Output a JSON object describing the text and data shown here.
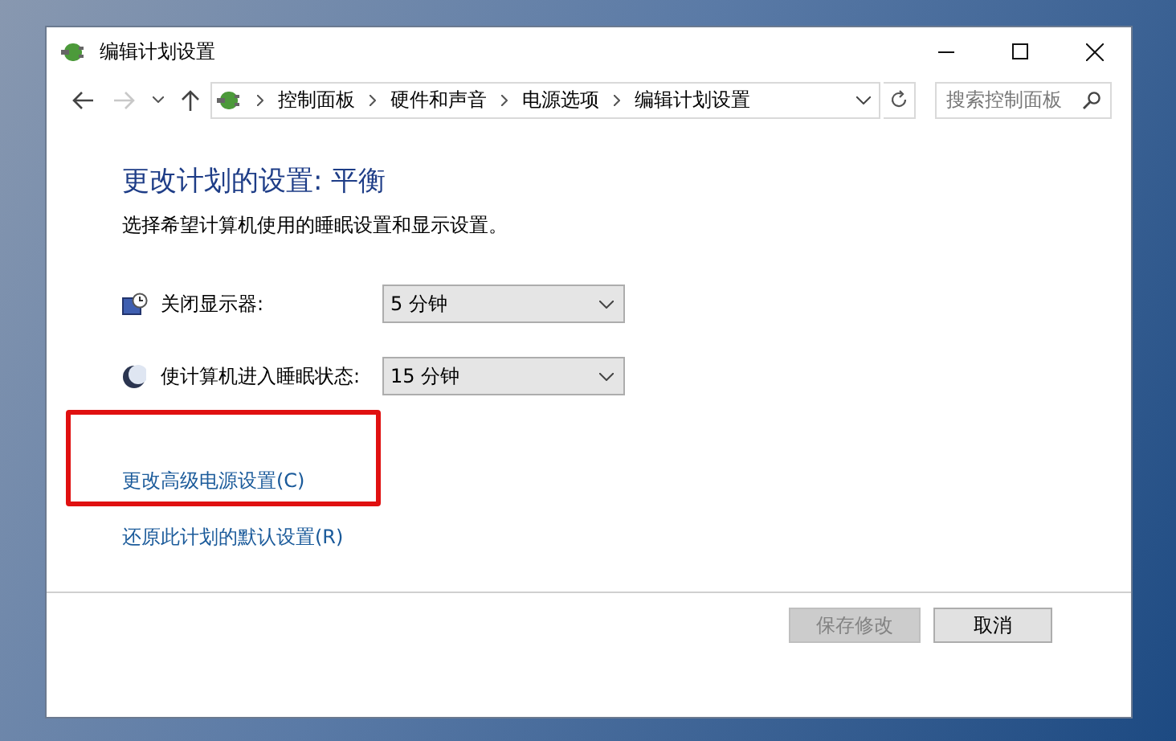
{
  "window": {
    "title": "编辑计划设置"
  },
  "address_bar": {
    "breadcrumbs": [
      "控制面板",
      "硬件和声音",
      "电源选项",
      "编辑计划设置"
    ]
  },
  "nav": {
    "back_disabled": false,
    "forward_disabled": true
  },
  "search": {
    "placeholder": "搜索控制面板"
  },
  "heading": "更改计划的设置: 平衡",
  "description": "选择希望计算机使用的睡眠设置和显示设置。",
  "settings": [
    {
      "kind": "display",
      "label": "关闭显示器:",
      "value": "5 分钟"
    },
    {
      "kind": "sleep",
      "label": "使计算机进入睡眠状态:",
      "value": "15 分钟"
    }
  ],
  "links": [
    {
      "label": "更改高级电源设置(C)",
      "highlighted": true
    },
    {
      "label": "还原此计划的默认设置(R)",
      "highlighted": false
    }
  ],
  "buttons": [
    {
      "label": "保存修改",
      "disabled": true
    },
    {
      "label": "取消",
      "disabled": false
    }
  ]
}
